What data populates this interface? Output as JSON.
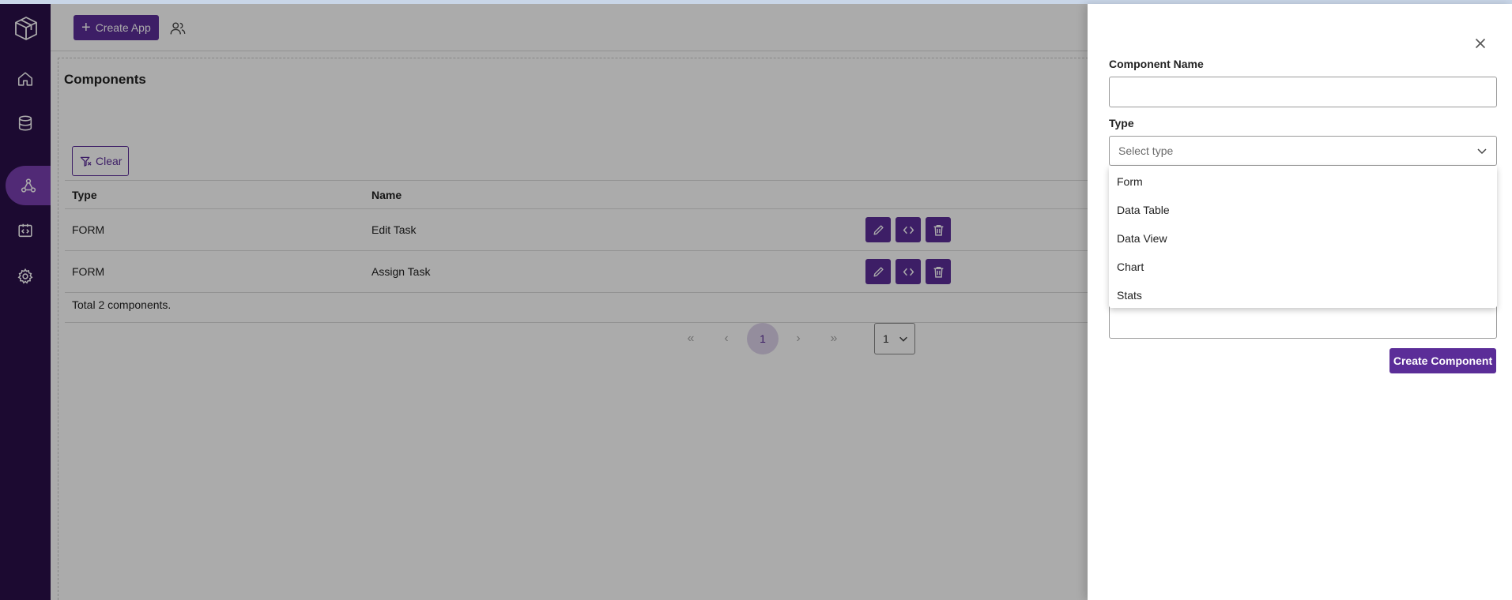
{
  "header": {
    "create_app_label": "Create App"
  },
  "page": {
    "title": "Components",
    "clear_label": "Clear"
  },
  "table": {
    "columns": [
      "Type",
      "Name"
    ],
    "rows": [
      {
        "type": "FORM",
        "name": "Edit Task"
      },
      {
        "type": "FORM",
        "name": "Assign Task"
      }
    ],
    "total_text": "Total 2 components."
  },
  "pagination": {
    "current_page": "1",
    "page_size_value": "1"
  },
  "drawer": {
    "name_label": "Component Name",
    "name_value": "",
    "type_label": "Type",
    "type_placeholder": "Select type",
    "type_options": [
      "Form",
      "Data Table",
      "Data View",
      "Chart",
      "Stats"
    ],
    "submit_label": "Create Component"
  },
  "colors": {
    "sidebar": "#2a0f49",
    "accent": "#5b2d98",
    "active_nav": "#7a3fb0"
  }
}
